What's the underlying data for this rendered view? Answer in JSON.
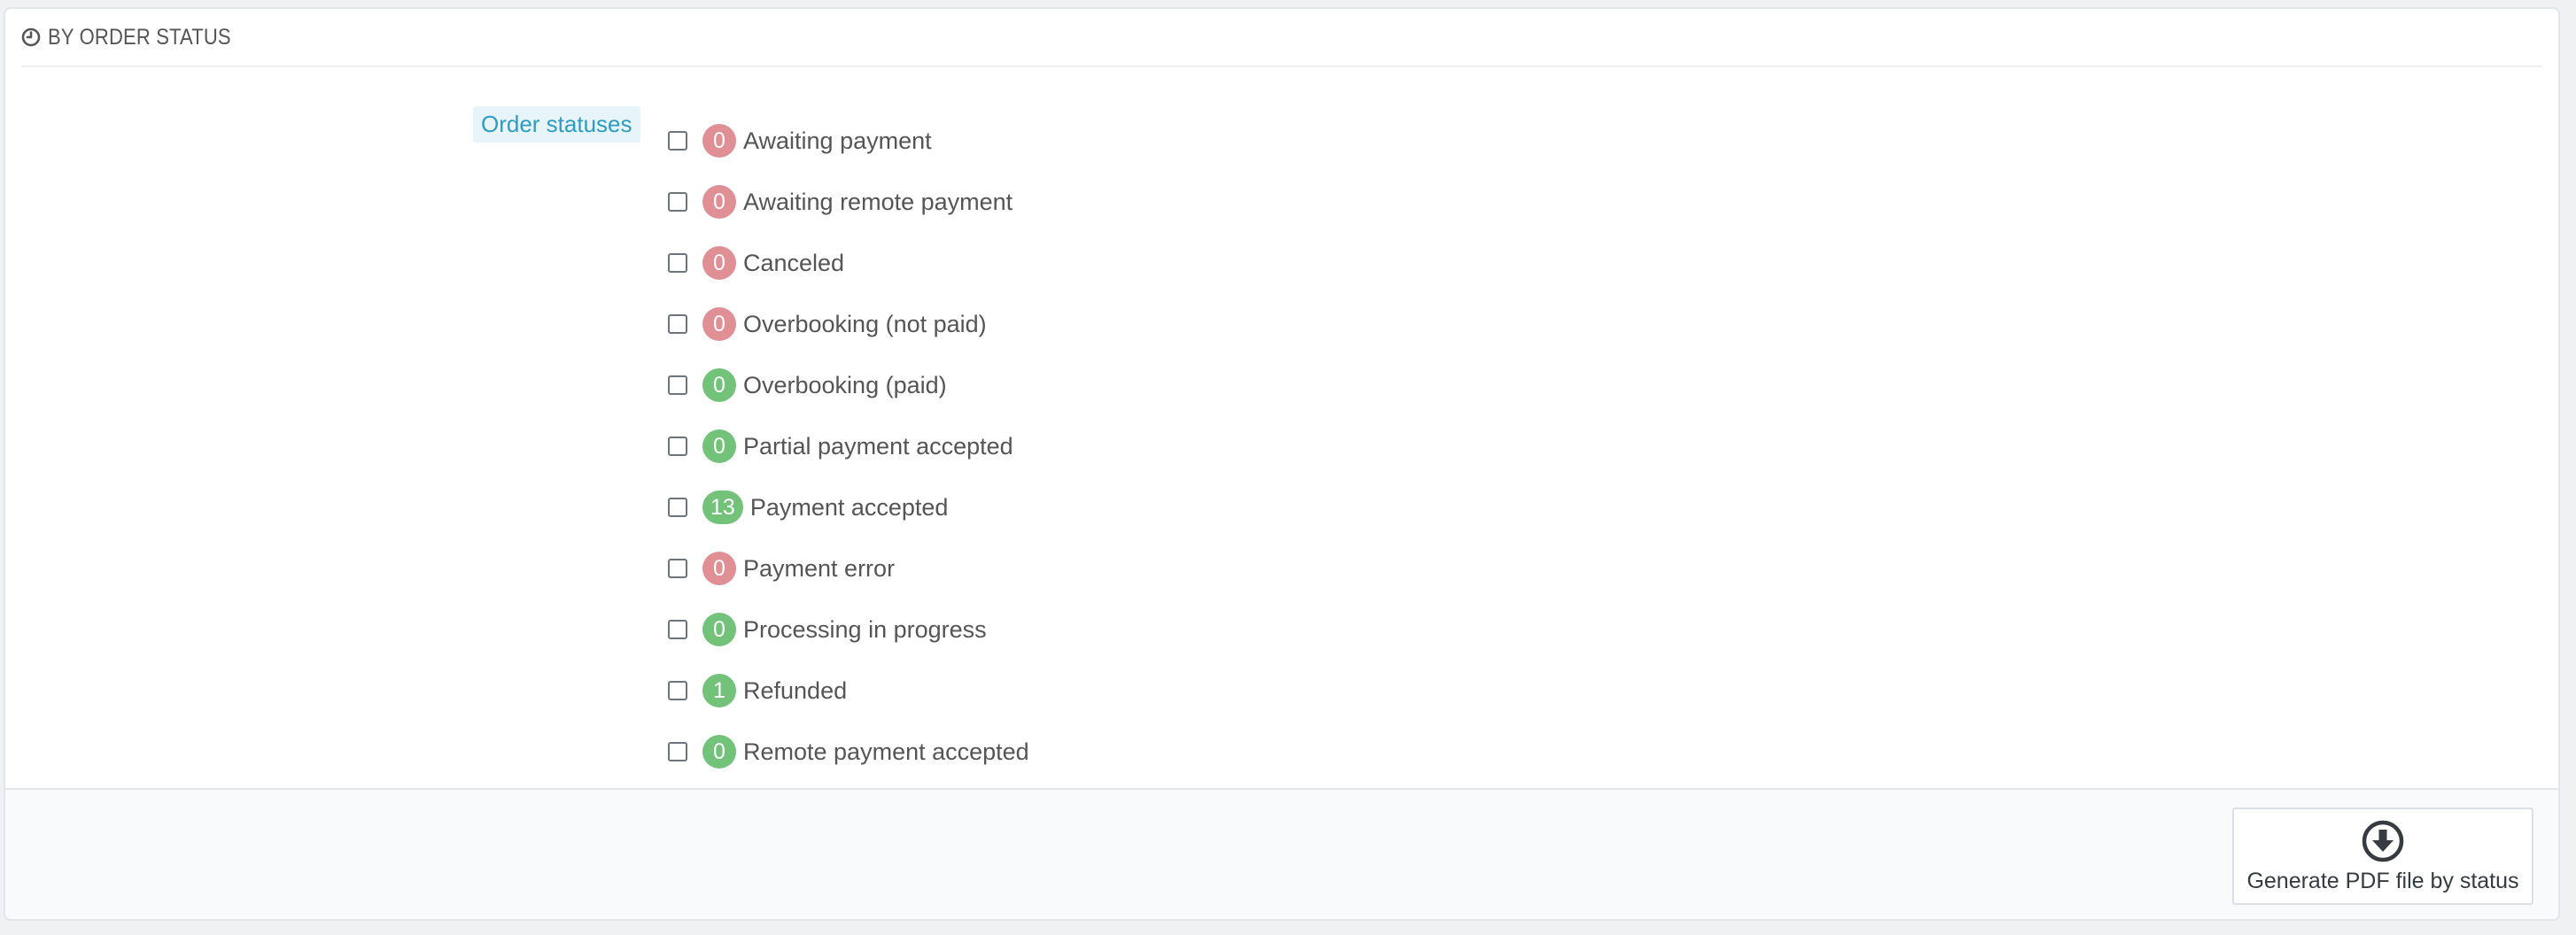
{
  "panel": {
    "title": "BY ORDER STATUS",
    "icon": "clock-icon"
  },
  "form": {
    "label": "Order statuses"
  },
  "statuses": [
    {
      "count": "0",
      "label": "Awaiting payment",
      "color": "#e08f95"
    },
    {
      "count": "0",
      "label": "Awaiting remote payment",
      "color": "#e08f95"
    },
    {
      "count": "0",
      "label": "Canceled",
      "color": "#e08f95"
    },
    {
      "count": "0",
      "label": "Overbooking (not paid)",
      "color": "#e08f95"
    },
    {
      "count": "0",
      "label": "Overbooking (paid)",
      "color": "#72c279"
    },
    {
      "count": "0",
      "label": "Partial payment accepted",
      "color": "#72c279"
    },
    {
      "count": "13",
      "label": "Payment accepted",
      "color": "#72c279"
    },
    {
      "count": "0",
      "label": "Payment error",
      "color": "#e08f95"
    },
    {
      "count": "0",
      "label": "Processing in progress",
      "color": "#72c279"
    },
    {
      "count": "1",
      "label": "Refunded",
      "color": "#72c279"
    },
    {
      "count": "0",
      "label": "Remote payment accepted",
      "color": "#72c279"
    }
  ],
  "footer": {
    "button_label": "Generate PDF file by status",
    "button_icon": "download-circle-icon"
  }
}
